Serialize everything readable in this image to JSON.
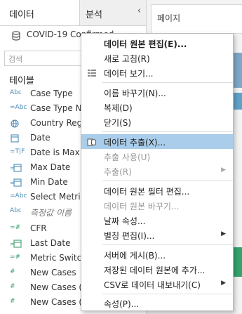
{
  "tabs": {
    "data": "데이터",
    "analysis": "분석",
    "pages": "페이지"
  },
  "datasource": {
    "name": "COVID-19 Confirmed ..."
  },
  "search": {
    "placeholder": "검색"
  },
  "tables_header": "테이블",
  "fields": [
    {
      "icon": "Abc",
      "name": "Case Type"
    },
    {
      "icon": "=Abc",
      "name": "Case Type No..."
    },
    {
      "icon": "globe",
      "name": "Country Regi..."
    },
    {
      "icon": "cal",
      "name": "Date"
    },
    {
      "icon": "=T|F",
      "name": "Date is Max"
    },
    {
      "icon": "cal",
      "name": "Max Date"
    },
    {
      "icon": "cal",
      "name": "Min Date"
    },
    {
      "icon": "=Abc",
      "name": "Select Metric"
    },
    {
      "icon": "Abc",
      "name": "측정값 이름"
    },
    {
      "icon": "=#",
      "name": "CFR"
    },
    {
      "icon": "=cal",
      "name": "Last Date"
    },
    {
      "icon": "=#",
      "name": "Metric Switch"
    },
    {
      "icon": "#",
      "name": "New Cases"
    },
    {
      "icon": "#",
      "name": "New Cases (C..."
    },
    {
      "icon": "#",
      "name": "New Cases (D..."
    }
  ],
  "menu": {
    "items": [
      {
        "label": "데이터 원본 편집(E)...",
        "bold": true
      },
      {
        "label": "새로 고침(R)"
      },
      {
        "label": "데이터 보기..."
      },
      {
        "label": "이름 바꾸기(N)..."
      },
      {
        "label": "복제(D)"
      },
      {
        "label": "닫기(S)"
      },
      {
        "label": "데이터 추출(X)...",
        "highlight": true
      },
      {
        "label": "추출 사용(U)",
        "disabled": true
      },
      {
        "label": "추출(R)",
        "disabled": true,
        "submenu": true
      },
      {
        "label": "데이터 원본 필터 편집..."
      },
      {
        "label": "데이터 원본 바꾸기...",
        "disabled": true
      },
      {
        "label": "날짜 속성..."
      },
      {
        "label": "별칭 편집(I)...",
        "submenu": true
      },
      {
        "label": "서버에 게시(B)..."
      },
      {
        "label": "저장된 데이터 원본에 추가..."
      },
      {
        "label": "CSV로 데이터 내보내기(C)",
        "submenu": true
      },
      {
        "label": "속성(P)..."
      }
    ]
  }
}
